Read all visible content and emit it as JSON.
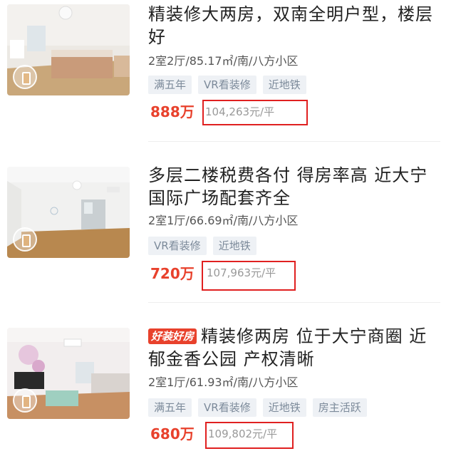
{
  "listings": [
    {
      "title": "精装修大两房，双南全明户型，楼层好",
      "badge": "",
      "meta": "2室2厅/85.17㎡/南/八方小区",
      "tags": [
        "满五年",
        "VR看装修",
        "近地铁"
      ],
      "price": "888万",
      "unit_price": "104,263元/平"
    },
    {
      "title": "多层二楼税费各付 得房率高 近大宁国际广场配套齐全",
      "badge": "",
      "meta": "2室1厅/66.69㎡/南/八方小区",
      "tags": [
        "VR看装修",
        "近地铁"
      ],
      "price": "720万",
      "unit_price": "107,963元/平"
    },
    {
      "title": "精装修两房 位于大宁商圈 近郁金香公园 产权清晰",
      "badge": "好装好房",
      "meta": "2室1厅/61.93㎡/南/八方小区",
      "tags": [
        "满五年",
        "VR看装修",
        "近地铁",
        "房主活跃"
      ],
      "price": "680万",
      "unit_price": "109,802元/平"
    }
  ],
  "colors": {
    "price": "#e8412c",
    "highlight": "#e02020",
    "tag_bg": "#eef1f5",
    "tag_text": "#7c8a9a"
  },
  "icons": {
    "vr": "vr-tour-icon"
  }
}
